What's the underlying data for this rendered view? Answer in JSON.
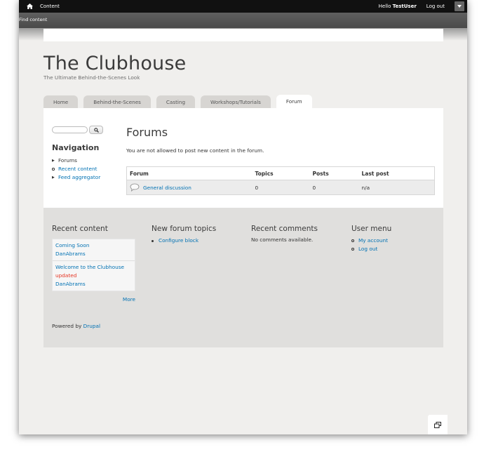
{
  "toolbar": {
    "content_label": "Content",
    "hello_prefix": "Hello ",
    "username": "TestUser",
    "logout_label": "Log out"
  },
  "shortcuts": {
    "find_content": "Find content"
  },
  "site": {
    "name": "The Clubhouse",
    "slogan": "The Ultimate Behind-the-Scenes Look"
  },
  "tabs": [
    {
      "label": "Home"
    },
    {
      "label": "Behind-the-Scenes"
    },
    {
      "label": "Casting"
    },
    {
      "label": "Workshops/Tutorials"
    },
    {
      "label": "Forum"
    }
  ],
  "sidebar": {
    "navigation_title": "Navigation",
    "items": [
      {
        "label": "Forums"
      },
      {
        "label": "Recent content"
      },
      {
        "label": "Feed aggregator"
      }
    ]
  },
  "main": {
    "title": "Forums",
    "notice": "You are not allowed to post new content in the forum.",
    "table": {
      "headers": [
        "Forum",
        "Topics",
        "Posts",
        "Last post"
      ],
      "rows": [
        {
          "forum": "General discussion",
          "topics": "0",
          "posts": "0",
          "last_post": "n/a"
        }
      ]
    }
  },
  "footer": {
    "recent_content": {
      "title": "Recent content",
      "items": [
        {
          "title": "Coming Soon",
          "author": "DanAbrams"
        },
        {
          "title": "Welcome to the Clubhouse",
          "badge": "updated",
          "author": "DanAbrams"
        }
      ],
      "more_label": "More"
    },
    "new_forum_topics": {
      "title": "New forum topics",
      "items": [
        {
          "label": "Configure block"
        }
      ]
    },
    "recent_comments": {
      "title": "Recent comments",
      "empty_text": "No comments available."
    },
    "user_menu": {
      "title": "User menu",
      "items": [
        {
          "label": "My account"
        },
        {
          "label": "Log out"
        }
      ]
    },
    "powered_prefix": "Powered by ",
    "powered_link": "Drupal"
  },
  "colors": {
    "link": "#0071b3",
    "updated": "#e53322",
    "toolbar": "#111111"
  }
}
